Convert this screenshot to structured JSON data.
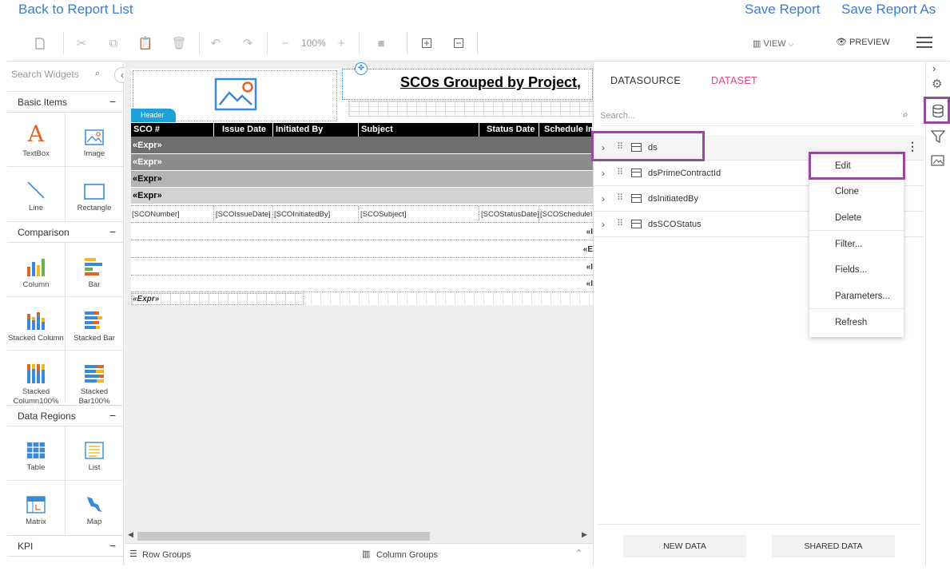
{
  "topnav": {
    "back": "Back to Report List",
    "save": "Save Report",
    "save_as": "Save Report As"
  },
  "toolbar": {
    "zoom": "100%",
    "view": "VIEW",
    "preview": "PREVIEW"
  },
  "sidebar": {
    "search_placeholder": "Search Widgets",
    "sections": {
      "basic": "Basic Items",
      "comparison": "Comparison",
      "data_regions": "Data Regions",
      "kpi": "KPI"
    },
    "basic": [
      "TextBox",
      "Image",
      "Line",
      "Rectangle"
    ],
    "comparison": [
      "Column",
      "Bar",
      "Stacked Column",
      "Stacked Bar",
      "Stacked Column100%",
      "Stacked Bar100%"
    ],
    "data_regions": [
      "Table",
      "List",
      "Matrix",
      "Map"
    ]
  },
  "report": {
    "title": "SCOs Grouped by Project,",
    "header_tab": "Header",
    "columns": [
      "SCO #",
      "Issue Date",
      "Initiated By",
      "Subject",
      "Status Date",
      "Schedule Im"
    ],
    "expr": "«Expr»",
    "footer_expr": "«Expr»",
    "data_cells": [
      "[SCONumber]",
      "[SCOIssueDate]",
      "[SCOInitiatedBy]",
      "[SCOSubject]",
      "[SCOStatusDate]",
      "[SCOScheduleI"
    ],
    "right_exprs": [
      "«I",
      "«E",
      "«I",
      "«I"
    ]
  },
  "canvas": {
    "row_groups": "Row Groups",
    "column_groups": "Column Groups"
  },
  "panel": {
    "tab_datasource": "DATASOURCE",
    "tab_dataset": "DATASET",
    "search_placeholder": "Search...",
    "datasets": [
      "ds",
      "dsPrimeContractId",
      "dsInitiatedBy",
      "dsSCOStatus"
    ],
    "menu": [
      "Edit",
      "Clone",
      "Delete",
      "Filter...",
      "Fields...",
      "Parameters...",
      "Refresh"
    ],
    "new_data": "NEW DATA",
    "shared_data": "SHARED DATA"
  },
  "colors": {
    "link": "#3d7cc9",
    "accent": "#e0457b",
    "highlight": "#944b9c",
    "header_tab": "#1fa0d8"
  }
}
